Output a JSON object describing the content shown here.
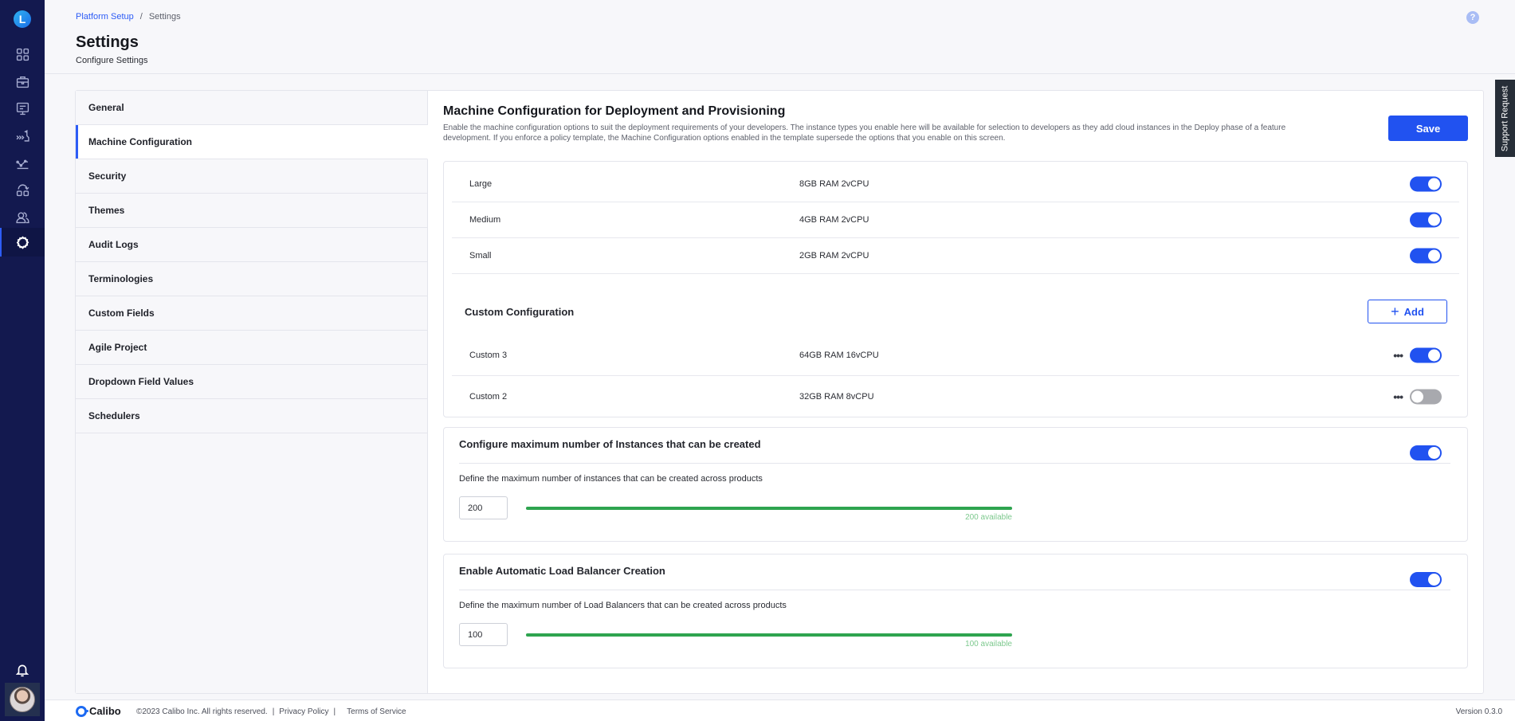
{
  "rail": {
    "logo_letter": "L",
    "items": [
      {
        "icon": "dashboard-icon"
      },
      {
        "icon": "briefcase-icon"
      },
      {
        "icon": "presentation-icon"
      },
      {
        "icon": "deploy-icon"
      },
      {
        "icon": "analytics-icon"
      },
      {
        "icon": "integrations-icon"
      },
      {
        "icon": "users-icon"
      },
      {
        "icon": "gear-icon",
        "active": true
      }
    ]
  },
  "header": {
    "breadcrumb": {
      "parent": "Platform Setup",
      "separator": "/",
      "current": "Settings"
    },
    "title": "Settings",
    "subtitle": "Configure Settings",
    "help_glyph": "?"
  },
  "settings_nav": [
    {
      "label": "General"
    },
    {
      "label": "Machine Configuration",
      "active": true
    },
    {
      "label": "Security"
    },
    {
      "label": "Themes"
    },
    {
      "label": "Audit Logs"
    },
    {
      "label": "Terminologies"
    },
    {
      "label": "Custom Fields"
    },
    {
      "label": "Agile Project"
    },
    {
      "label": "Dropdown Field Values"
    },
    {
      "label": "Schedulers"
    }
  ],
  "content": {
    "title": "Machine Configuration for Deployment and Provisioning",
    "description": "Enable the machine configuration options to suit the deployment requirements of your developers. The instance types you enable here will be available for selection to developers as they add cloud instances in the Deploy phase of a feature development. If you enforce a policy template, the Machine Configuration options enabled in the template supersede the options that you enable on this screen.",
    "save_label": "Save",
    "standard_configs": [
      {
        "name": "Large",
        "spec": "8GB RAM 2vCPU",
        "enabled": true
      },
      {
        "name": "Medium",
        "spec": "4GB RAM 2vCPU",
        "enabled": true
      },
      {
        "name": "Small",
        "spec": "2GB RAM 2vCPU",
        "enabled": true
      }
    ],
    "custom_heading": "Custom Configuration",
    "add_label": "Add",
    "custom_configs": [
      {
        "name": "Custom 3",
        "spec": "64GB RAM 16vCPU",
        "enabled": true
      },
      {
        "name": "Custom 2",
        "spec": "32GB RAM 8vCPU",
        "enabled": false
      }
    ],
    "instances_limit": {
      "title": "Configure maximum number of Instances that can be created",
      "enabled": true,
      "description": "Define the maximum number of instances that can be created across products",
      "value": "200",
      "available_fraction": 1.0,
      "available_label": "200 available"
    },
    "load_balancer_limit": {
      "title": "Enable Automatic Load Balancer Creation",
      "enabled": true,
      "description": "Define the maximum number of Load Balancers that can be created across products",
      "value": "100",
      "available_fraction": 1.0,
      "available_label": "100 available"
    }
  },
  "support_tab": "Support Request",
  "footer": {
    "brand": "Calibo",
    "copyright": "©2023 Calibo Inc. All rights reserved.",
    "sep": "|",
    "privacy": "Privacy Policy",
    "terms": "Terms of Service",
    "version": "Version 0.3.0"
  },
  "colors": {
    "accent": "#2152f0",
    "rail_bg": "#13194f",
    "progress": "#2ea44f",
    "toggle_off": "#a8a9ae"
  }
}
